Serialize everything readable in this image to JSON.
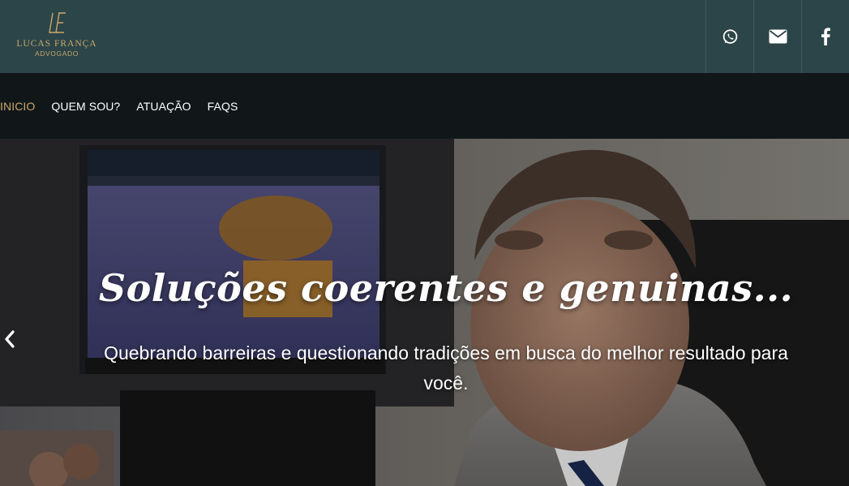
{
  "brand": {
    "name": "LUCAS FRANÇA",
    "subtitle": "ADVOGADO",
    "accent_color": "#c9a86a",
    "bar_color": "#2c4548"
  },
  "social": [
    {
      "icon": "whatsapp-icon",
      "label": "WhatsApp"
    },
    {
      "icon": "envelope-icon",
      "label": "E-mail"
    },
    {
      "icon": "facebook-icon",
      "label": "Facebook"
    }
  ],
  "nav": {
    "items": [
      {
        "label": "INICIO",
        "active": true
      },
      {
        "label": "QUEM SOU?",
        "active": false
      },
      {
        "label": "ATUAÇÃO",
        "active": false
      },
      {
        "label": "FAQS",
        "active": false
      }
    ]
  },
  "hero": {
    "title": "Soluções coerentes e genuinas...",
    "subtitle": "Quebrando barreiras e questionando tradições em busca do melhor resultado para você.",
    "prev_icon": "chevron-left-icon"
  }
}
